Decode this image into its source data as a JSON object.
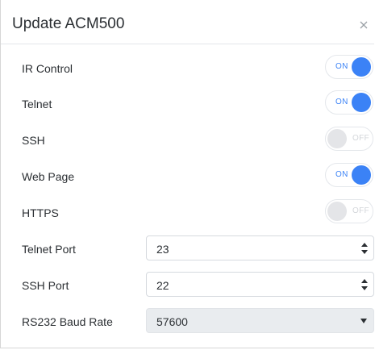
{
  "dialog": {
    "title": "Update ACM500",
    "close_icon": "close-icon"
  },
  "toggles": [
    {
      "label": "IR Control",
      "state": "ON"
    },
    {
      "label": "Telnet",
      "state": "ON"
    },
    {
      "label": "SSH",
      "state": "OFF"
    },
    {
      "label": "Web Page",
      "state": "ON"
    },
    {
      "label": "HTTPS",
      "state": "OFF"
    }
  ],
  "telnet_port": {
    "label": "Telnet Port",
    "value": "23"
  },
  "ssh_port": {
    "label": "SSH Port",
    "value": "22"
  },
  "baud_rate": {
    "label": "RS232 Baud Rate",
    "value": "57600"
  },
  "colors": {
    "accent": "#3b82f6",
    "off_knob": "#e4e5e8"
  }
}
